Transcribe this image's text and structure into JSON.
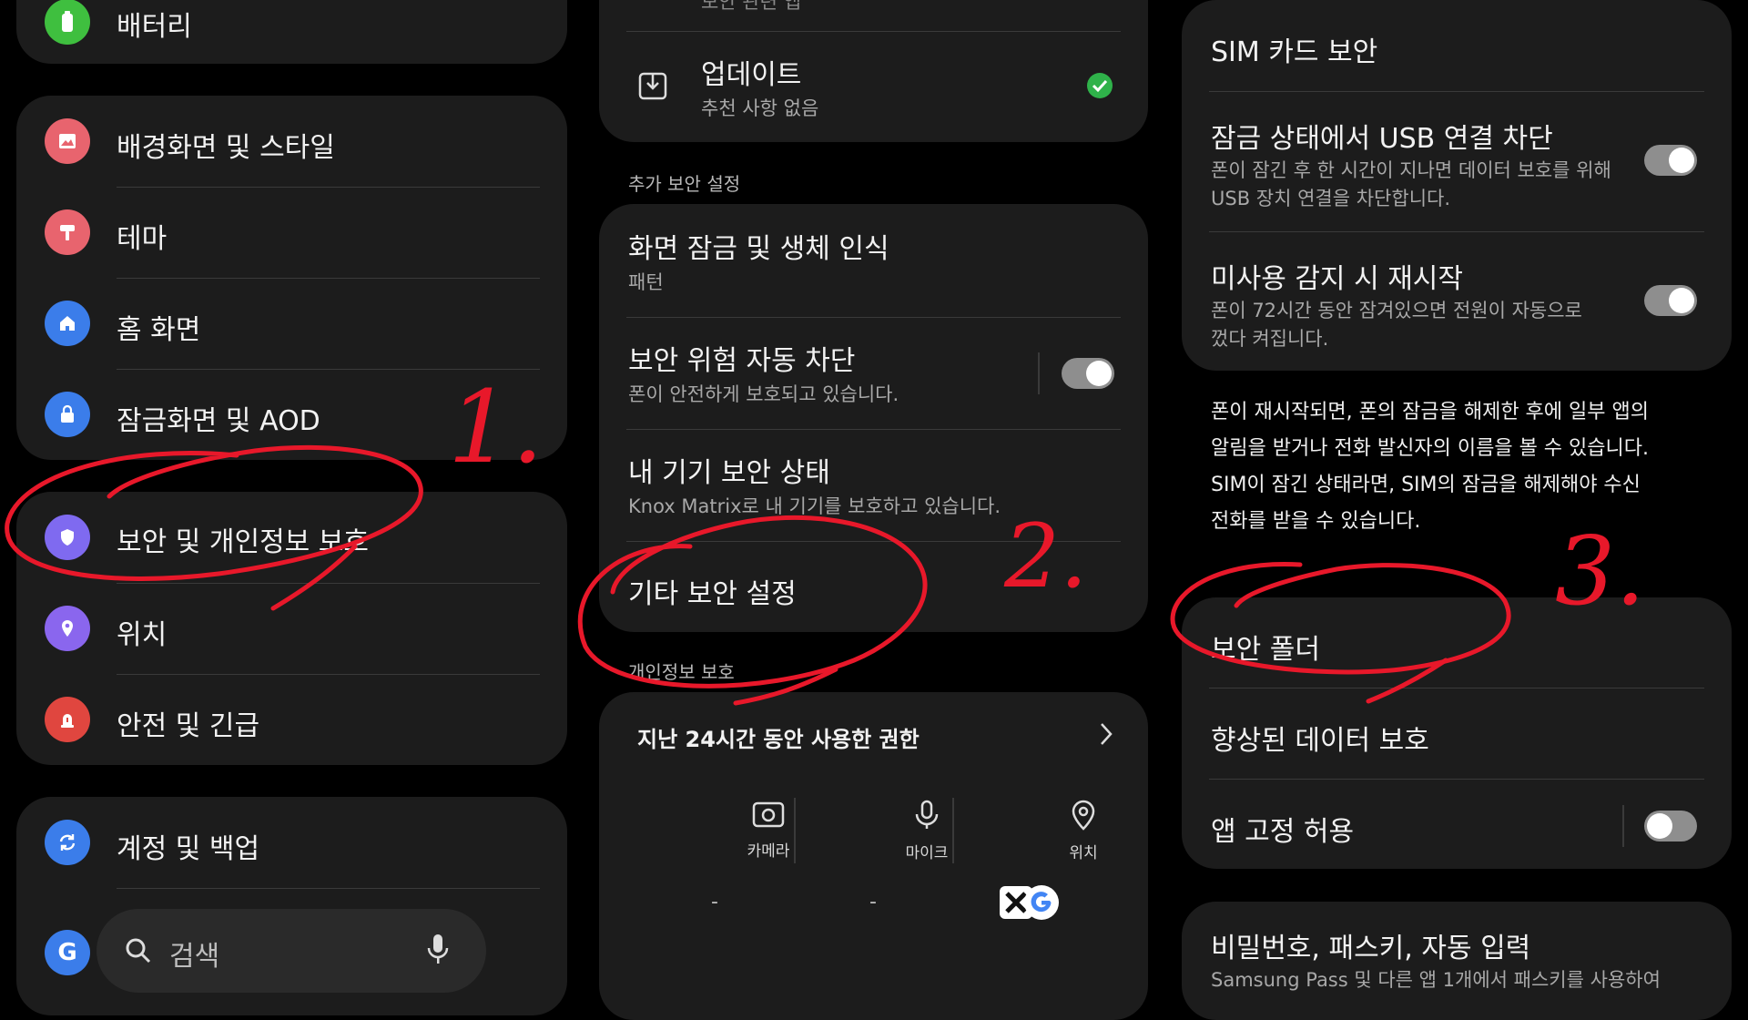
{
  "left": {
    "battery_label": "배터리",
    "items": [
      {
        "label": "배경화면 및 스타일"
      },
      {
        "label": "테마"
      },
      {
        "label": "홈 화면"
      },
      {
        "label": "잠금화면 및 AOD"
      }
    ],
    "items2": [
      {
        "label": "보안 및 개인정보 보호"
      },
      {
        "label": "위치"
      },
      {
        "label": "안전 및 긴급"
      }
    ],
    "items3": [
      {
        "label": "계정 및 백업"
      }
    ],
    "search_placeholder": "검색",
    "g_letter": "G"
  },
  "middle": {
    "top_partial": "보안 관련 앱",
    "update_title": "업데이트",
    "update_sub": "추천 사항 없음",
    "section_title": "추가 보안 설정",
    "items": [
      {
        "title": "화면 잠금 및 생체 인식",
        "sub": "패턴"
      },
      {
        "title": "보안 위험 자동 차단",
        "sub": "폰이 안전하게 보호되고 있습니다."
      },
      {
        "title": "내 기기 보안 상태",
        "sub": "Knox Matrix로 내 기기를 보호하고 있습니다."
      },
      {
        "title": "기타 보안 설정"
      }
    ],
    "section2_title": "개인정보 보호",
    "perm_header": "지난 24시간 동안 사용한 권한",
    "perms": [
      {
        "label": "카메라",
        "value": "-"
      },
      {
        "label": "마이크",
        "value": "-"
      },
      {
        "label": "위치"
      }
    ]
  },
  "right": {
    "sim": "SIM 카드 보안",
    "usb_title": "잠금 상태에서 USB 연결 차단",
    "usb_sub1": "폰이 잠긴 후 한 시간이 지나면 데이터 보호를 위해",
    "usb_sub2": "USB 장치 연결을 차단합니다.",
    "restart_title": "미사용 감지 시 재시작",
    "restart_sub1": "폰이 72시간 동안 잠겨있으면 전원이 자동으로",
    "restart_sub2": "껐다 켜집니다.",
    "note_lines": [
      "폰이 재시작되면, 폰의 잠금을 해제한 후에 일부 앱의",
      "알림을 받거나 전화 발신자의 이름을 볼 수 있습니다.",
      "SIM이 잠긴 상태라면, SIM의 잠금을 해제해야 수신",
      "전화를 받을 수 있습니다."
    ],
    "secure_folder": "보안 폴더",
    "enhanced": "향상된 데이터 보호",
    "app_pin": "앱 고정 허용",
    "password_title": "비밀번호, 패스키, 자동 입력",
    "password_sub": "Samsung Pass 및 다른 앱 1개에서 패스키를 사용하여"
  },
  "annotations": {
    "one": "1.",
    "two": "2.",
    "three": "3."
  },
  "colors": {
    "battery": "#3fbf3f",
    "wallpaper": "#e8646e",
    "theme": "#e8646e",
    "home": "#3b7dea",
    "lock": "#3b7dea",
    "security": "#7f6af0",
    "location": "#8a66ee",
    "safety": "#e0463f",
    "account": "#3b7dea",
    "google": "#3b7dea",
    "check": "#2fb24a",
    "marker": "#e8182a"
  }
}
